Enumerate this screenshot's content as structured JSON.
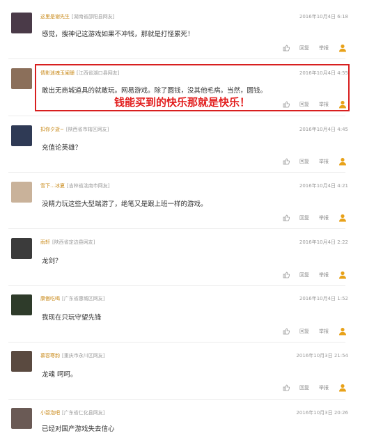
{
  "comments": [
    {
      "user": "这里是谢先生",
      "location": "[湖南省邵阳县网友]",
      "time": "2016年10月4日 6:18",
      "text": "感觉，搜神记这游戏如果不冲钱，那就是打怪累死！",
      "avatar_color": "#4a3a48"
    },
    {
      "user": "倩影迷魂玉阑珊",
      "location": "[江西省湖口县网友]",
      "time": "2016年10月4日 4:55",
      "text": "敢出无商城道具的就敢玩。网易游戏。除了圆钱，没其他毛病。当然，圆钱。",
      "avatar_color": "#8b6f5a"
    },
    {
      "user": "扣你夕逝~",
      "location": "[陕西省市辖区网友]",
      "time": "2016年10月4日 4:45",
      "text": "充值论英雄？",
      "avatar_color": "#2f3a55"
    },
    {
      "user": "雪下…冰夏",
      "location": "[吉林省洮南市网友]",
      "time": "2016年10月4日 4:21",
      "text": "没精力玩这些大型端游了，绝笔又是跟上班一样的游戏。",
      "avatar_color": "#c9b29a"
    },
    {
      "user": "雨轩",
      "location": "[陕西省定边县网友]",
      "time": "2016年10月4日 2:22",
      "text": "龙剑？",
      "avatar_color": "#3b3b3b"
    },
    {
      "user": "康傲吃喝",
      "location": "[广东省惠城区网友]",
      "time": "2016年10月4日 1:52",
      "text": "我现在只玩守望先锋",
      "avatar_color": "#2e3b2a"
    },
    {
      "user": "慕容寒韵",
      "location": "[重庆市永川区网友]",
      "time": "2016年10月3日 21:54",
      "text": "龙魂 呵呵。",
      "avatar_color": "#5a4a40"
    },
    {
      "user": "小碧泡吧",
      "location": "[广东省仁化县网友]",
      "time": "2016年10月3日 20:26",
      "text": "已经对国产游戏失去信心",
      "avatar_color": "#6a5a55"
    }
  ],
  "actions": {
    "reply": "回复",
    "report": "举报"
  },
  "overlay": {
    "text": "钱能买到的快乐那就是快乐！"
  },
  "icons": {
    "like": "thumbs-up-icon",
    "user": "user-icon"
  },
  "colors": {
    "username": "#c98a1a",
    "highlight": "#d81f1f",
    "user_icon": "#e8a21a"
  }
}
